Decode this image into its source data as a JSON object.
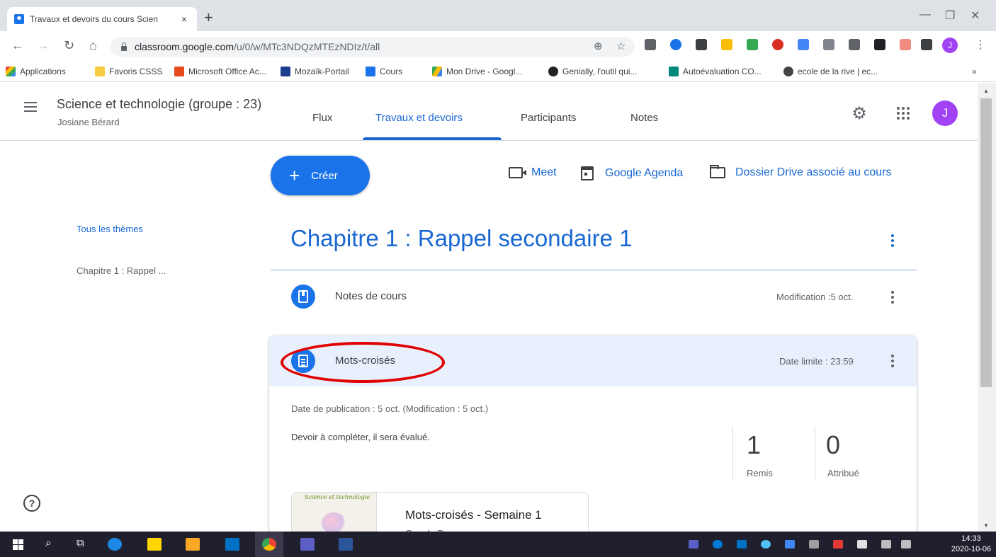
{
  "browser": {
    "tab_title": "Travaux et devoirs du cours Scien",
    "tab_close": "×",
    "new_tab": "+",
    "url_host": "classroom.google.com",
    "url_path": "/u/0/w/MTc3NDQzMTEzNDIz/t/all",
    "profile_initial": "J",
    "bookmarks": [
      {
        "label": "Applications",
        "icon_color": "#ea4335"
      },
      {
        "label": "Favoris CSSS",
        "icon_color": "#f9cb40"
      },
      {
        "label": "Microsoft Office Ac...",
        "icon_color": "#e64a19"
      },
      {
        "label": "Mozaïk-Portail",
        "icon_color": "#1a3e8c"
      },
      {
        "label": "Cours",
        "icon_color": "#1a73e8"
      },
      {
        "label": "Mon Drive - Googl...",
        "icon_color": "#34a853"
      },
      {
        "label": "Genially, l'outil qui...",
        "icon_color": "#222222"
      },
      {
        "label": "Autoévaluation CO...",
        "icon_color": "#00897b"
      },
      {
        "label": "ecole de la rive | ec...",
        "icon_color": "#444444"
      }
    ],
    "bookmarks_more": "»"
  },
  "classroom": {
    "course_name": "Science et technologie (groupe : 23)",
    "teacher": "Josiane Bérard",
    "nav_tabs": [
      "Flux",
      "Travaux et devoirs",
      "Participants",
      "Notes"
    ],
    "active_tab": "Travaux et devoirs",
    "avatar_initial": "J",
    "accent_color": "#1967d2"
  },
  "toolbar": {
    "create_label": "Créer",
    "meet_label": "Meet",
    "calendar_label": "Google Agenda",
    "drive_label": "Dossier Drive associé au cours"
  },
  "sidebar": {
    "all_topics": "Tous les thèmes",
    "topic_item": "Chapitre 1 : Rappel ..."
  },
  "topic": {
    "title": "Chapitre 1 : Rappel secondaire 1",
    "items": [
      {
        "title": "Notes de cours",
        "meta": "Modification :5 oct.",
        "icon": "material-icon"
      },
      {
        "title": "Mots-croisés",
        "meta": "Date limite : 23:59",
        "icon": "assignment-icon"
      }
    ]
  },
  "assignment": {
    "pub_date": "Date de publication : 5 oct. (Modification : 5 oct.)",
    "description": "Devoir à compléter, il sera évalué.",
    "turned_in_count": "1",
    "turned_in_label": "Remis",
    "assigned_count": "0",
    "assigned_label": "Attribué",
    "attachment_title": "Mots-croisés - Semaine 1",
    "attachment_type": "Google Docs",
    "attachment_thumb_caption": "Science et technologie"
  },
  "taskbar": {
    "time": "14:33",
    "date": "2020-10-06"
  }
}
